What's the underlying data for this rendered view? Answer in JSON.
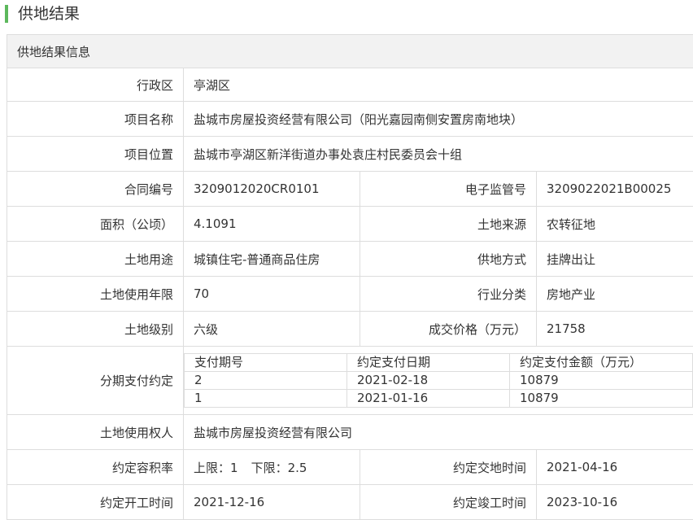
{
  "page_title": "供地结果",
  "section_title": "供地结果信息",
  "rows": {
    "district": {
      "label": "行政区",
      "value": "亭湖区"
    },
    "project_name": {
      "label": "项目名称",
      "value": "盐城市房屋投资经营有限公司（阳光嘉园南侧安置房南地块）"
    },
    "project_location": {
      "label": "项目位置",
      "value": "盐城市亭湖区新洋街道办事处袁庄村民委员会十组"
    },
    "contract_no": {
      "label": "合同编号",
      "value": "3209012020CR0101"
    },
    "e_supervision_no": {
      "label": "电子监管号",
      "value": "3209022021B00025"
    },
    "area": {
      "label": "面积（公顷）",
      "value": "4.1091"
    },
    "land_source": {
      "label": "土地来源",
      "value": "农转征地"
    },
    "land_use": {
      "label": "土地用途",
      "value": "城镇住宅-普通商品住房"
    },
    "supply_method": {
      "label": "供地方式",
      "value": "挂牌出让"
    },
    "use_years": {
      "label": "土地使用年限",
      "value": "70"
    },
    "industry": {
      "label": "行业分类",
      "value": "房地产业"
    },
    "land_grade": {
      "label": "土地级别",
      "value": "六级"
    },
    "deal_price": {
      "label": "成交价格（万元）",
      "value": "21758"
    },
    "installments": {
      "label": "分期支付约定",
      "headers": [
        "支付期号",
        "约定支付日期",
        "约定支付金额（万元）"
      ],
      "items": [
        [
          "2",
          "2021-02-18",
          "10879"
        ],
        [
          "1",
          "2021-01-16",
          "10879"
        ]
      ]
    },
    "land_user": {
      "label": "土地使用权人",
      "value": "盐城市房屋投资经营有限公司"
    },
    "plot_ratio": {
      "label": "约定容积率",
      "upper_label": "上限：",
      "upper_value": "1",
      "lower_label": "下限：",
      "lower_value": "2.5"
    },
    "delivery_time": {
      "label": "约定交地时间",
      "value": "2021-04-16"
    },
    "start_time": {
      "label": "约定开工时间",
      "value": "2021-12-16"
    },
    "completion_time": {
      "label": "约定竣工时间",
      "value": "2023-10-16"
    }
  }
}
